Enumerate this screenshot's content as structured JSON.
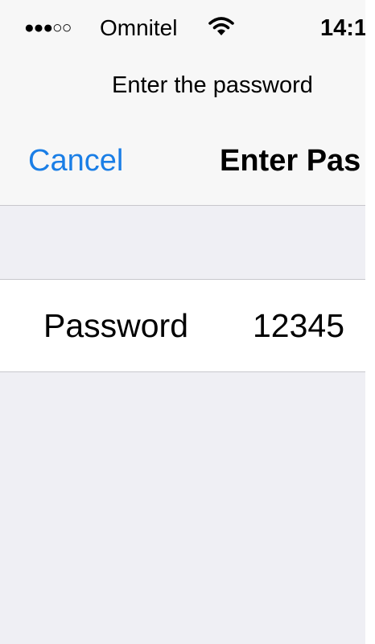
{
  "status_bar": {
    "signal": "●●●○○",
    "carrier": "Omnitel",
    "time": "14:1",
    "wifi_icon": "wifi-icon"
  },
  "prompt": "Enter the password",
  "nav": {
    "cancel_label": "Cancel",
    "title": "Enter Pas"
  },
  "form": {
    "password_label": "Password",
    "password_value": "12345"
  },
  "colors": {
    "accent": "#1a7ee6",
    "background": "#efeff4",
    "bar": "#f7f7f7"
  }
}
